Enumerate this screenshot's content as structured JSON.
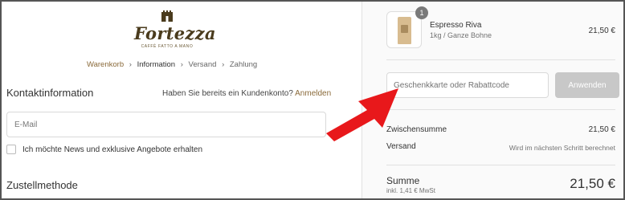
{
  "brand": {
    "name": "Fortezza",
    "tagline": "CAFFÈ FATTO A MANO"
  },
  "breadcrumb": {
    "cart": "Warenkorb",
    "information": "Information",
    "shipping": "Versand",
    "payment": "Zahlung",
    "separator": "›"
  },
  "contact": {
    "title": "Kontaktinformation",
    "login_prompt": "Haben Sie bereits ein Kundenkonto?",
    "login_link": "Anmelden",
    "email_placeholder": "E-Mail",
    "newsletter_label": "Ich möchte News und exklusive Angebote erhalten",
    "newsletter_checked": false
  },
  "shipping": {
    "title": "Zustellmethode"
  },
  "order": {
    "item": {
      "quantity": "1",
      "name": "Espresso Riva",
      "variant": "1kg / Ganze Bohne",
      "price": "21,50 €"
    },
    "discount_placeholder": "Geschenkkarte oder Rabattcode",
    "apply_label": "Anwenden",
    "subtotal_label": "Zwischensumme",
    "subtotal_value": "21,50 €",
    "shipping_label": "Versand",
    "shipping_value": "Wird im nächsten Schritt berechnet",
    "total_label": "Summe",
    "tax_note": "inkl. 1,41 € MwSt",
    "total_value": "21,50 €"
  },
  "colors": {
    "accent": "#8a6a3a",
    "arrow": "#e8181b",
    "button_disabled": "#c8c8c8"
  }
}
